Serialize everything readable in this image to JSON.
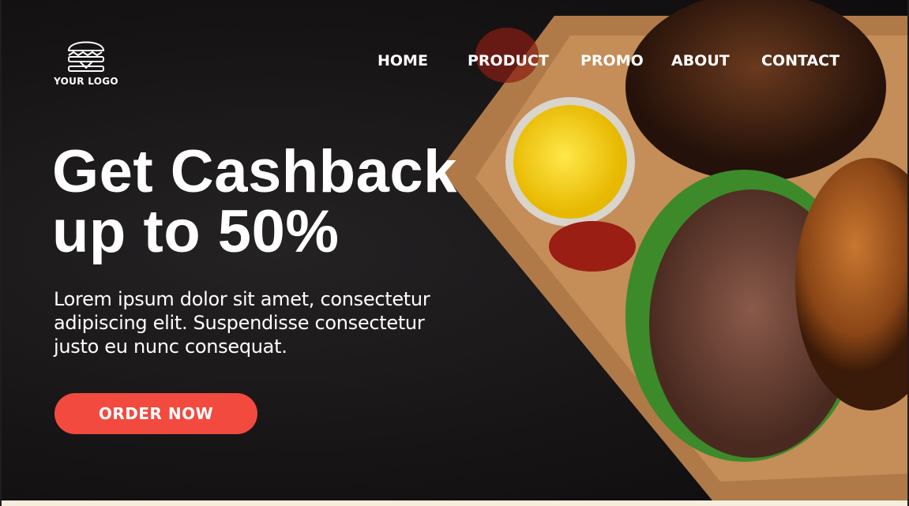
{
  "logo": {
    "text": "YOUR LOGO",
    "icon": "burger-icon"
  },
  "nav": {
    "items": [
      "HOME",
      "PRODUCT",
      "PROMO",
      "ABOUT",
      "CONTACT"
    ]
  },
  "hero": {
    "title_line1": "Get Cashback",
    "title_line2": "up to 50%",
    "description": "Lorem ipsum dolor sit amet, consectetur adipiscing elit. Suspendisse consectetur justo eu nunc consequat.",
    "cta": "ORDER NOW"
  },
  "colors": {
    "accent": "#f24a3f",
    "background": "#161415",
    "footer_strip": "#f5eedd"
  }
}
